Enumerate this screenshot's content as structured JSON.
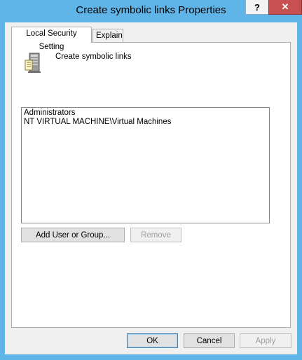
{
  "window": {
    "title": "Create symbolic links Properties",
    "help_glyph": "?",
    "close_glyph": "✕"
  },
  "tabs": [
    {
      "label": "Local Security Setting",
      "selected": true
    },
    {
      "label": "Explain",
      "selected": false
    }
  ],
  "policy": {
    "name": "Create symbolic links",
    "icon": "server-policy-icon"
  },
  "accounts": [
    "Administrators",
    "NT VIRTUAL MACHINE\\Virtual Machines"
  ],
  "buttons": {
    "add": "Add User or Group...",
    "remove": "Remove",
    "ok": "OK",
    "cancel": "Cancel",
    "apply": "Apply"
  },
  "colors": {
    "frame": "#5fb4e8",
    "close": "#c75050"
  }
}
